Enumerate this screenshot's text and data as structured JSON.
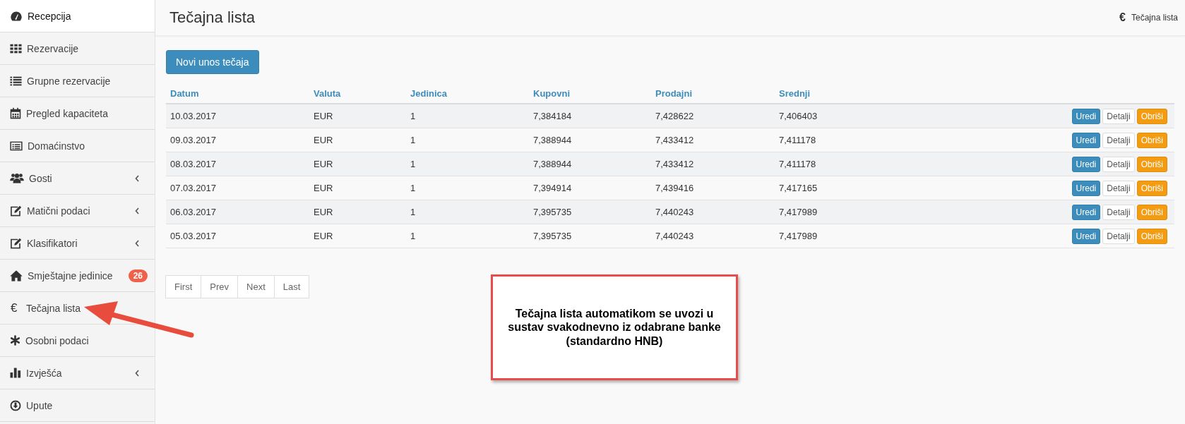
{
  "sidebar": {
    "items": [
      {
        "label": "Recepcija",
        "selected": true,
        "submenu": false
      },
      {
        "label": "Rezervacije",
        "selected": false,
        "submenu": false
      },
      {
        "label": "Grupne rezervacije",
        "selected": false,
        "submenu": false
      },
      {
        "label": "Pregled kapaciteta",
        "selected": false,
        "submenu": false
      },
      {
        "label": "Domaćinstvo",
        "selected": false,
        "submenu": false
      },
      {
        "label": "Gosti",
        "selected": false,
        "submenu": true
      },
      {
        "label": "Matični podaci",
        "selected": false,
        "submenu": true
      },
      {
        "label": "Klasifikatori",
        "selected": false,
        "submenu": true
      },
      {
        "label": "Smještajne jedinice",
        "selected": false,
        "submenu": false,
        "badge": "26"
      },
      {
        "symbol": "€",
        "label": "Tečajna lista",
        "selected": false,
        "submenu": false
      },
      {
        "label": "Osobni podaci",
        "selected": false,
        "submenu": false
      },
      {
        "label": "Izvješća",
        "selected": false,
        "submenu": true
      },
      {
        "label": "Upute",
        "selected": false,
        "submenu": false
      }
    ]
  },
  "header": {
    "title": "Tečajna lista",
    "breadcrumb": {
      "symbol": "€",
      "label": "Tečajna lista"
    }
  },
  "new_button": "Novi unos tečaja",
  "table": {
    "columns": [
      "Datum",
      "Valuta",
      "Jedinica",
      "Kupovni",
      "Prodajni",
      "Srednji"
    ],
    "rows": [
      {
        "cells": [
          "10.03.2017",
          "EUR",
          "1",
          "7,384184",
          "7,428622",
          "7,406403"
        ],
        "actions": [
          "Uredi",
          "Detalji",
          "Obriši"
        ]
      },
      {
        "cells": [
          "09.03.2017",
          "EUR",
          "1",
          "7,388944",
          "7,433412",
          "7,411178"
        ],
        "actions": [
          "Uredi",
          "Detalji",
          "Obriši"
        ]
      },
      {
        "cells": [
          "08.03.2017",
          "EUR",
          "1",
          "7,388944",
          "7,433412",
          "7,411178"
        ],
        "actions": [
          "Uredi",
          "Detalji",
          "Obriši"
        ]
      },
      {
        "cells": [
          "07.03.2017",
          "EUR",
          "1",
          "7,394914",
          "7,439416",
          "7,417165"
        ],
        "actions": [
          "Uredi",
          "Detalji",
          "Obriši"
        ]
      },
      {
        "cells": [
          "06.03.2017",
          "EUR",
          "1",
          "7,395735",
          "7,440243",
          "7,417989"
        ],
        "actions": [
          "Uredi",
          "Detalji",
          "Obriši"
        ]
      },
      {
        "cells": [
          "05.03.2017",
          "EUR",
          "1",
          "7,395735",
          "7,440243",
          "7,417989"
        ],
        "actions": [
          "Uredi",
          "Detalji",
          "Obriši"
        ]
      }
    ]
  },
  "pagination": [
    "First",
    "Prev",
    "Next",
    "Last"
  ],
  "callout": {
    "text": "Tečajna lista automatikom se uvozi u sustav svakodnevno iz odabrane banke (standardno HNB)"
  }
}
